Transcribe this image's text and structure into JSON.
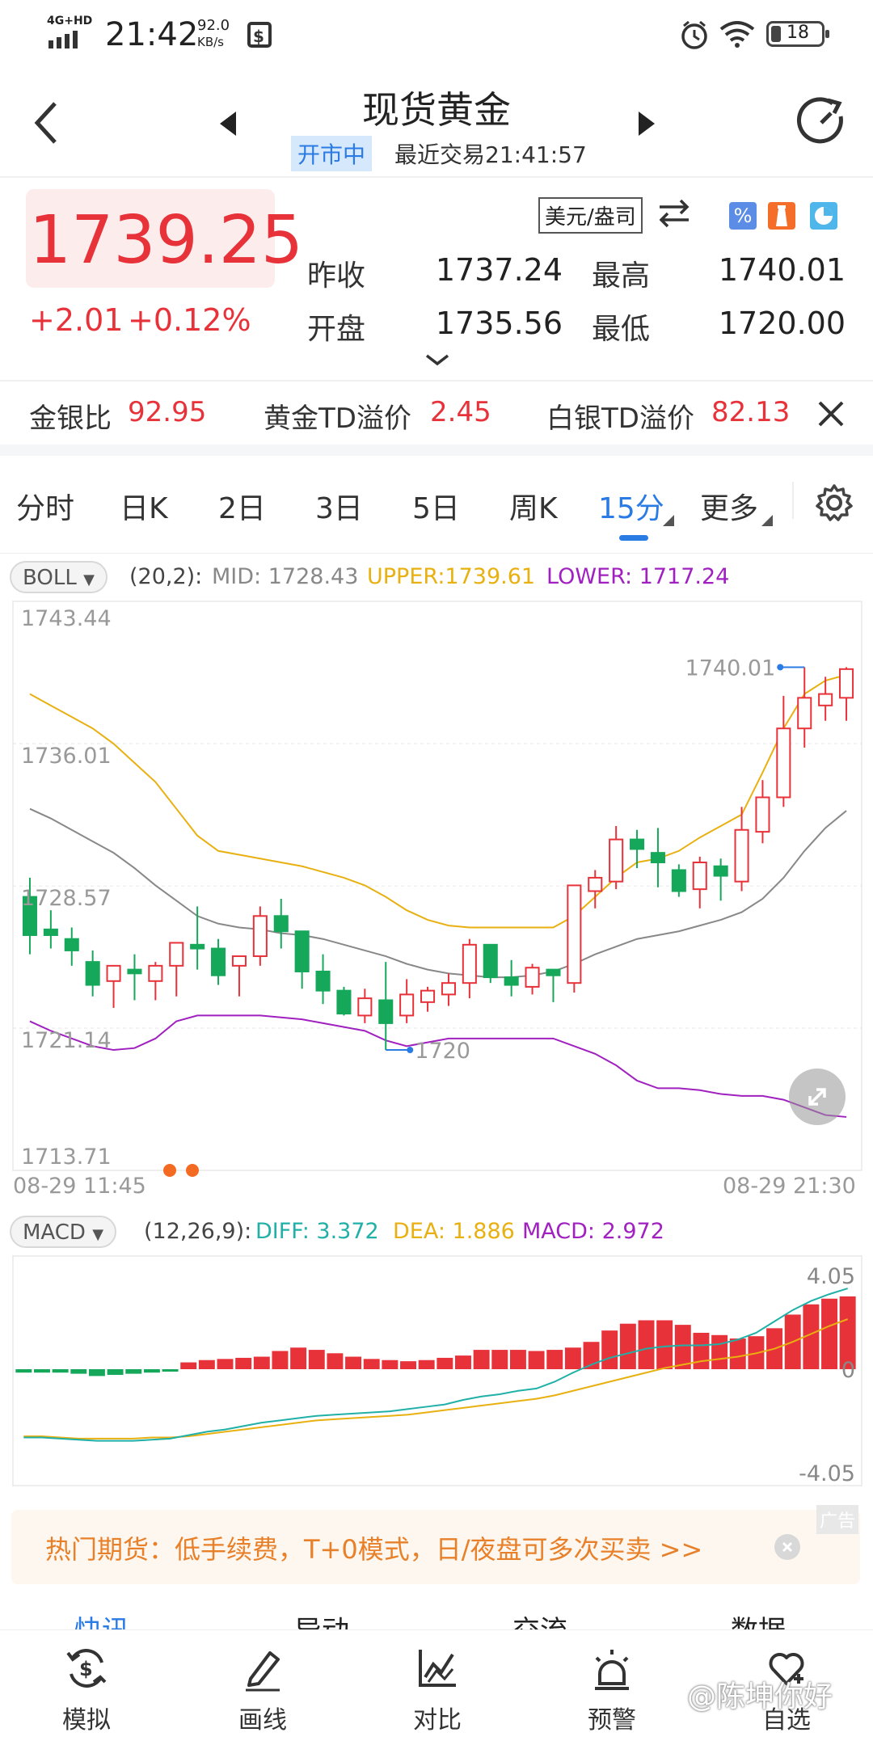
{
  "status_bar": {
    "network": "4G+HD",
    "time": "21:42",
    "speed_value": "92.0",
    "speed_unit": "KB/s",
    "battery": "18"
  },
  "header": {
    "title": "现货黄金",
    "market_status": "开市中",
    "last_trade": "最近交易21:41:57"
  },
  "quote": {
    "price": "1739.25",
    "change": "+2.01",
    "change_pct": "+0.12%",
    "unit": "美元/盎司",
    "prev_close_label": "昨收",
    "prev_close": "1737.24",
    "open_label": "开盘",
    "open": "1735.56",
    "high_label": "最高",
    "high": "1740.01",
    "low_label": "最低",
    "low": "1720.00"
  },
  "ratio_bar": {
    "items": [
      {
        "label": "金银比",
        "value": "92.95"
      },
      {
        "label": "黄金TD溢价",
        "value": "2.45"
      },
      {
        "label": "白银TD溢价",
        "value": "82.13"
      }
    ]
  },
  "tabs": [
    "分时",
    "日K",
    "2日",
    "3日",
    "5日",
    "周K",
    "15分",
    "更多"
  ],
  "active_tab": "15分",
  "boll": {
    "name": "BOLL",
    "params": "(20,2):",
    "mid": "MID: 1728.43",
    "upper": "UPPER:1739.61",
    "lower": "LOWER: 1717.24",
    "colors": {
      "mid": "#888888",
      "upper": "#e8b010",
      "lower": "#a020c0"
    }
  },
  "macd": {
    "name": "MACD",
    "params": "(12,26,9):",
    "diff": "DIFF: 3.372",
    "dea": "DEA: 1.886",
    "macd": "MACD: 2.972",
    "colors": {
      "diff": "#20b0a8",
      "dea": "#e8b010",
      "macd": "#a020c0"
    }
  },
  "chart_data": [
    {
      "type": "candlestick",
      "title": "",
      "y_ticks": [
        "1743.44",
        "1736.01",
        "1728.57",
        "1721.14",
        "1713.71"
      ],
      "ylim": [
        1713.71,
        1743.44
      ],
      "x_start_label": "08-29 11:45",
      "x_end_label": "08-29 21:30",
      "max_label": "1740.01",
      "min_label": "1720",
      "candles": [
        {
          "o": 1728.0,
          "h": 1729.0,
          "l": 1725.0,
          "c": 1726.0
        },
        {
          "o": 1726.3,
          "h": 1727.3,
          "l": 1725.3,
          "c": 1726.0
        },
        {
          "o": 1725.8,
          "h": 1726.4,
          "l": 1724.4,
          "c": 1725.2
        },
        {
          "o": 1724.6,
          "h": 1725.2,
          "l": 1722.8,
          "c": 1723.4
        },
        {
          "o": 1723.6,
          "h": 1724.4,
          "l": 1722.2,
          "c": 1724.4
        },
        {
          "o": 1724.2,
          "h": 1725.0,
          "l": 1722.6,
          "c": 1724.0
        },
        {
          "o": 1723.6,
          "h": 1724.6,
          "l": 1722.6,
          "c": 1724.4
        },
        {
          "o": 1724.4,
          "h": 1725.6,
          "l": 1722.8,
          "c": 1725.6
        },
        {
          "o": 1725.5,
          "h": 1727.5,
          "l": 1724.2,
          "c": 1725.3
        },
        {
          "o": 1725.3,
          "h": 1725.8,
          "l": 1723.4,
          "c": 1723.9
        },
        {
          "o": 1724.4,
          "h": 1724.9,
          "l": 1722.8,
          "c": 1724.9
        },
        {
          "o": 1724.9,
          "h": 1727.5,
          "l": 1724.4,
          "c": 1727.0
        },
        {
          "o": 1727.0,
          "h": 1727.9,
          "l": 1725.3,
          "c": 1726.2
        },
        {
          "o": 1726.2,
          "h": 1726.2,
          "l": 1723.2,
          "c": 1724.1
        },
        {
          "o": 1724.1,
          "h": 1725.0,
          "l": 1722.4,
          "c": 1723.1
        },
        {
          "o": 1723.1,
          "h": 1723.3,
          "l": 1721.8,
          "c": 1721.9
        },
        {
          "o": 1721.8,
          "h": 1723.2,
          "l": 1721.4,
          "c": 1722.7
        },
        {
          "o": 1722.6,
          "h": 1724.6,
          "l": 1720.0,
          "c": 1721.4
        },
        {
          "o": 1721.8,
          "h": 1723.7,
          "l": 1721.4,
          "c": 1722.9
        },
        {
          "o": 1722.5,
          "h": 1723.3,
          "l": 1722.0,
          "c": 1723.1
        },
        {
          "o": 1722.9,
          "h": 1724.0,
          "l": 1722.3,
          "c": 1723.5
        },
        {
          "o": 1723.5,
          "h": 1725.8,
          "l": 1722.7,
          "c": 1725.5
        },
        {
          "o": 1725.5,
          "h": 1725.5,
          "l": 1723.5,
          "c": 1723.8
        },
        {
          "o": 1723.8,
          "h": 1724.7,
          "l": 1722.8,
          "c": 1723.4
        },
        {
          "o": 1723.3,
          "h": 1724.5,
          "l": 1722.9,
          "c": 1724.3
        },
        {
          "o": 1724.2,
          "h": 1724.2,
          "l": 1722.5,
          "c": 1723.9
        },
        {
          "o": 1723.5,
          "h": 1728.6,
          "l": 1723.0,
          "c": 1728.6
        },
        {
          "o": 1728.3,
          "h": 1729.4,
          "l": 1727.4,
          "c": 1729.0
        },
        {
          "o": 1728.8,
          "h": 1731.7,
          "l": 1728.4,
          "c": 1731.0
        },
        {
          "o": 1731.0,
          "h": 1731.5,
          "l": 1729.5,
          "c": 1730.5
        },
        {
          "o": 1730.3,
          "h": 1731.6,
          "l": 1728.5,
          "c": 1729.8
        },
        {
          "o": 1729.4,
          "h": 1729.7,
          "l": 1728.0,
          "c": 1728.3
        },
        {
          "o": 1728.4,
          "h": 1730.1,
          "l": 1727.4,
          "c": 1729.8
        },
        {
          "o": 1729.6,
          "h": 1730.0,
          "l": 1727.8,
          "c": 1729.1
        },
        {
          "o": 1728.8,
          "h": 1732.7,
          "l": 1728.3,
          "c": 1731.5
        },
        {
          "o": 1731.4,
          "h": 1734.1,
          "l": 1730.8,
          "c": 1733.2
        },
        {
          "o": 1733.2,
          "h": 1738.5,
          "l": 1732.7,
          "c": 1736.8
        },
        {
          "o": 1736.8,
          "h": 1740.0,
          "l": 1735.8,
          "c": 1738.4
        },
        {
          "o": 1738.0,
          "h": 1739.5,
          "l": 1737.2,
          "c": 1738.6
        },
        {
          "o": 1738.4,
          "h": 1740.0,
          "l": 1737.2,
          "c": 1739.9
        }
      ],
      "upper": [
        1738.6,
        1738.0,
        1737.4,
        1736.8,
        1736.0,
        1735.0,
        1734.0,
        1732.6,
        1731.2,
        1730.4,
        1730.2,
        1730.0,
        1729.8,
        1729.6,
        1729.3,
        1729.0,
        1728.6,
        1728.0,
        1727.3,
        1726.8,
        1726.5,
        1726.4,
        1726.4,
        1726.4,
        1726.4,
        1726.4,
        1727.0,
        1728.0,
        1729.0,
        1729.8,
        1730.0,
        1730.4,
        1731.1,
        1731.7,
        1732.3,
        1734.5,
        1736.8,
        1738.6,
        1739.3,
        1739.6
      ],
      "mid": [
        1732.6,
        1732.1,
        1731.5,
        1730.9,
        1730.3,
        1729.5,
        1728.6,
        1727.8,
        1727.0,
        1726.6,
        1726.4,
        1726.3,
        1726.1,
        1726.0,
        1725.8,
        1725.5,
        1725.2,
        1724.9,
        1724.5,
        1724.2,
        1724.0,
        1723.9,
        1723.8,
        1723.8,
        1723.9,
        1724.1,
        1724.5,
        1725.0,
        1725.4,
        1725.8,
        1726.0,
        1726.2,
        1726.5,
        1726.8,
        1727.2,
        1727.9,
        1729.0,
        1730.4,
        1731.6,
        1732.5
      ],
      "lower": [
        1721.5,
        1721.0,
        1720.6,
        1720.2,
        1720.0,
        1720.1,
        1720.6,
        1721.5,
        1721.8,
        1721.8,
        1721.8,
        1721.8,
        1721.7,
        1721.6,
        1721.4,
        1721.2,
        1721.0,
        1720.5,
        1720.2,
        1720.4,
        1720.6,
        1720.6,
        1720.6,
        1720.6,
        1720.6,
        1720.6,
        1720.2,
        1719.8,
        1719.2,
        1718.4,
        1718.0,
        1718.0,
        1717.9,
        1717.7,
        1717.6,
        1717.6,
        1717.4,
        1717.0,
        1716.6,
        1716.5
      ]
    },
    {
      "type": "bar",
      "title": "",
      "y_ticks": [
        "4.05",
        "0",
        "-4.05"
      ],
      "ylim": [
        -4.05,
        4.05
      ],
      "macd_bars": [
        -0.15,
        -0.15,
        -0.15,
        -0.2,
        -0.3,
        -0.25,
        -0.2,
        -0.15,
        -0.05,
        0.3,
        0.4,
        0.45,
        0.5,
        0.55,
        0.8,
        0.95,
        0.85,
        0.7,
        0.55,
        0.45,
        0.4,
        0.35,
        0.4,
        0.5,
        0.6,
        0.85,
        0.85,
        0.85,
        0.8,
        0.85,
        0.95,
        1.2,
        1.7,
        2.0,
        2.15,
        2.15,
        1.95,
        1.6,
        1.5,
        1.35,
        1.45,
        1.8,
        2.4,
        2.85,
        3.1,
        3.2
      ],
      "diff": [
        -3.0,
        -3.0,
        -3.05,
        -3.1,
        -3.15,
        -3.15,
        -3.15,
        -3.1,
        -3.05,
        -2.9,
        -2.75,
        -2.65,
        -2.5,
        -2.35,
        -2.25,
        -2.15,
        -2.05,
        -2.0,
        -1.95,
        -1.9,
        -1.85,
        -1.75,
        -1.65,
        -1.55,
        -1.35,
        -1.2,
        -1.1,
        -0.95,
        -0.85,
        -0.55,
        -0.15,
        0.2,
        0.5,
        0.7,
        0.9,
        1.0,
        1.05,
        1.05,
        1.1,
        1.3,
        1.6,
        2.1,
        2.6,
        3.0,
        3.3,
        3.55
      ],
      "dea": [
        -2.95,
        -2.95,
        -3.0,
        -3.05,
        -3.05,
        -3.05,
        -3.05,
        -3.0,
        -3.0,
        -2.95,
        -2.85,
        -2.75,
        -2.65,
        -2.55,
        -2.45,
        -2.35,
        -2.25,
        -2.2,
        -2.15,
        -2.1,
        -2.05,
        -2.0,
        -1.9,
        -1.8,
        -1.7,
        -1.6,
        -1.5,
        -1.4,
        -1.3,
        -1.15,
        -0.95,
        -0.75,
        -0.55,
        -0.35,
        -0.15,
        0.05,
        0.2,
        0.35,
        0.45,
        0.55,
        0.7,
        0.9,
        1.2,
        1.55,
        1.9,
        2.2
      ]
    }
  ],
  "ad_banner": {
    "text": "热门期货：低手续费，T+0模式，日/夜盘可多次买卖 >>",
    "tag": "广告"
  },
  "sub_tabs": [
    "快讯",
    "异动",
    "交流",
    "数据"
  ],
  "bottom_nav": [
    {
      "label": "模拟",
      "icon": "dollar-refresh-icon"
    },
    {
      "label": "画线",
      "icon": "pen-icon"
    },
    {
      "label": "对比",
      "icon": "line-chart-icon"
    },
    {
      "label": "预警",
      "icon": "alarm-bell-icon"
    },
    {
      "label": "自选",
      "icon": "heart-plus-icon"
    }
  ],
  "watermark": "@陈坤你好"
}
